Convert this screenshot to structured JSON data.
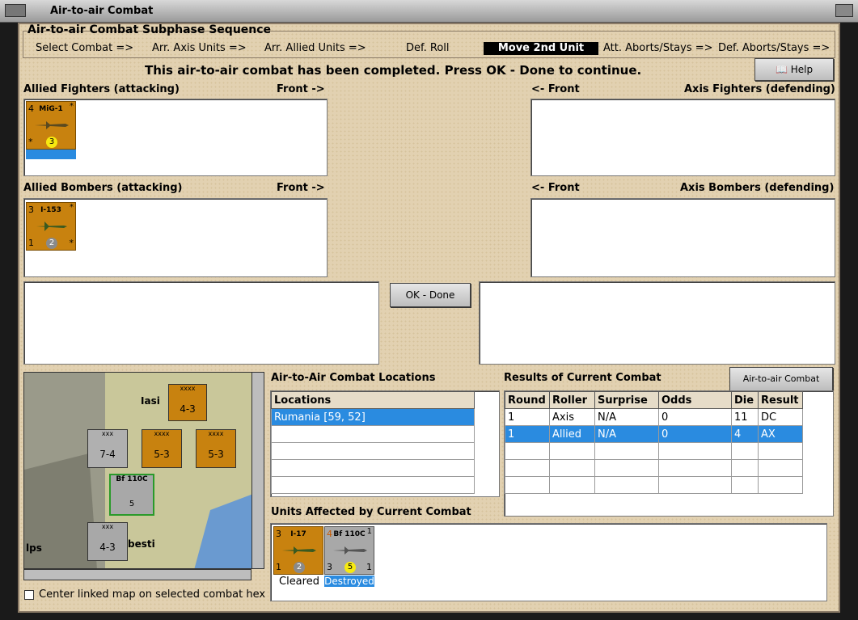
{
  "window": {
    "title": "Air-to-air Combat"
  },
  "sequence": {
    "heading": "Air-to-air Combat Subphase Sequence",
    "steps": [
      "Select Combat =>",
      "Arr. Axis Units =>",
      "Arr. Allied Units =>",
      "Def. Roll",
      "Move 2nd Unit",
      "Att. Aborts/Stays =>",
      "Def. Aborts/Stays =>"
    ],
    "active_index": 4
  },
  "status_message": "This air-to-air combat has been completed.  Press OK - Done to continue.",
  "help_label": "Help",
  "allied_fighters": {
    "label": "Allied Fighters (attacking)",
    "front": "Front ->",
    "counter": {
      "top": "4",
      "name": "MiG-1",
      "star": "*",
      "circle": "3",
      "bottom_left": "*"
    }
  },
  "axis_fighters": {
    "label": "Axis Fighters (defending)",
    "front": "<- Front"
  },
  "allied_bombers": {
    "label": "Allied Bombers (attacking)",
    "front": "Front ->",
    "counter": {
      "top": "3",
      "name": "I-153",
      "star": "*",
      "circle": "2",
      "bottom_left": "1",
      "bottom_right": "*"
    }
  },
  "axis_bombers": {
    "label": "Axis Bombers (defending)",
    "front": "<- Front"
  },
  "ok_button": "OK - Done",
  "locations": {
    "title": "Air-to-Air Combat Locations",
    "header": "Locations",
    "rows": [
      "Rumania [59, 52]"
    ]
  },
  "results": {
    "title": "Results of Current Combat",
    "chart_button": "Air-to-air Combat Chart",
    "columns": [
      "Round",
      "Roller",
      "Surprise",
      "Odds",
      "Die",
      "Result"
    ],
    "rows": [
      [
        "1",
        "Axis",
        "N/A",
        "0",
        "11",
        "DC"
      ],
      [
        "1",
        "Allied",
        "N/A",
        "0",
        "4",
        "AX"
      ]
    ]
  },
  "affected": {
    "title": "Units Affected by Current Combat",
    "units": [
      {
        "name": "I-17",
        "top": "3",
        "circle": "2",
        "bottom_left": "1",
        "status": "Cleared"
      },
      {
        "name": "Bf 110C",
        "top": "4",
        "circle": "5",
        "bottom_left": "3",
        "bottom_right": "1",
        "star": "1",
        "status": "Destroyed"
      }
    ]
  },
  "map": {
    "labels": [
      "Iasi",
      "lps",
      "besti"
    ],
    "counters": [
      {
        "name": "xxx",
        "value": "7-4",
        "stack": "2"
      },
      {
        "name": "xxxx",
        "value": "5-3",
        "stack": "2"
      },
      {
        "name": "xxxx",
        "value": "5-3",
        "stack": "2"
      },
      {
        "name": "xxxx",
        "value": "4-3"
      },
      {
        "name": "xxx",
        "value": "4-3",
        "stack": "2"
      },
      {
        "name": "Bf 110C",
        "value": "5",
        "stack": "7"
      }
    ]
  },
  "center_map_checkbox": "Center linked map on selected combat hex"
}
